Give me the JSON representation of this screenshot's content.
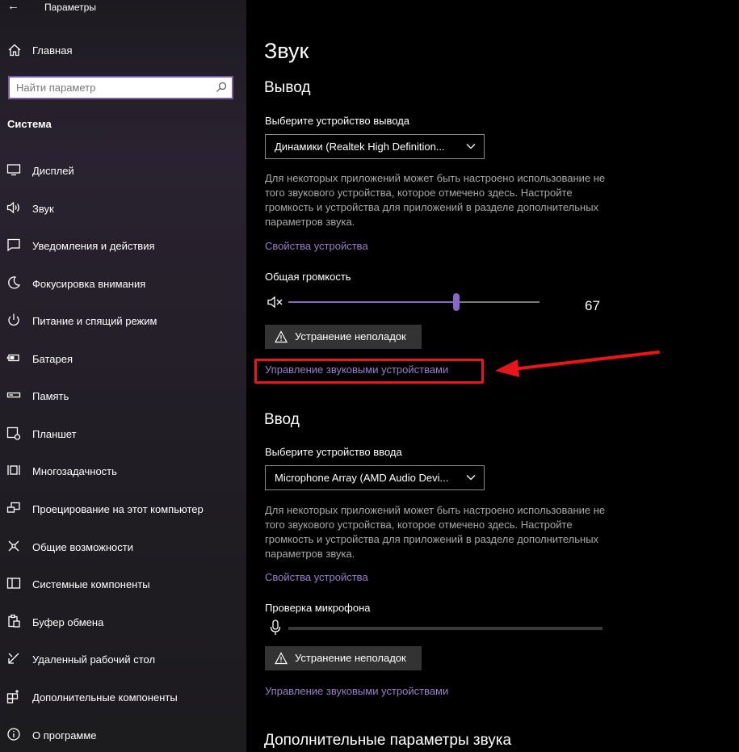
{
  "window": {
    "title": "Параметры"
  },
  "sidebar": {
    "home_label": "Главная",
    "search_placeholder": "Найти параметр",
    "section_title": "Система",
    "items": [
      {
        "label": "Дисплей",
        "icon": "display-icon"
      },
      {
        "label": "Звук",
        "icon": "speaker-icon"
      },
      {
        "label": "Уведомления и действия",
        "icon": "notification-icon"
      },
      {
        "label": "Фокусировка внимания",
        "icon": "moon-icon"
      },
      {
        "label": "Питание и спящий режим",
        "icon": "power-icon"
      },
      {
        "label": "Батарея",
        "icon": "battery-icon"
      },
      {
        "label": "Память",
        "icon": "storage-icon"
      },
      {
        "label": "Планшет",
        "icon": "tablet-icon"
      },
      {
        "label": "Многозадачность",
        "icon": "multitasking-icon"
      },
      {
        "label": "Проецирование на этот компьютер",
        "icon": "projecting-icon"
      },
      {
        "label": "Общие возможности",
        "icon": "shared-experiences-icon"
      },
      {
        "label": "Системные компоненты",
        "icon": "system-components-icon"
      },
      {
        "label": "Буфер обмена",
        "icon": "clipboard-icon"
      },
      {
        "label": "Удаленный рабочий стол",
        "icon": "remote-desktop-icon"
      },
      {
        "label": "Дополнительные компоненты",
        "icon": "optional-features-icon"
      },
      {
        "label": "О программе",
        "icon": "info-icon"
      }
    ]
  },
  "main": {
    "title": "Звук",
    "output": {
      "heading": "Вывод",
      "device_label": "Выберите устройство вывода",
      "device_value": "Динамики (Realtek High Definition...",
      "note": "Для некоторых приложений может быть настроено использование не того звукового устройства, которое отмечено здесь. Настройте громкость и устройства для приложений в разделе дополнительных параметров звука.",
      "properties_link": "Свойства устройства",
      "volume_label": "Общая громкость",
      "volume_value": "67",
      "volume_fraction": 0.67,
      "troubleshoot_label": "Устранение неполадок",
      "manage_link": "Управление звуковыми устройствами"
    },
    "input": {
      "heading": "Ввод",
      "device_label": "Выберите устройство ввода",
      "device_value": "Microphone Array (AMD Audio Devi...",
      "note": "Для некоторых приложений может быть настроено использование не того звукового устройства, которое отмечено здесь. Настройте громкость и устройства для приложений в разделе дополнительных параметров звука.",
      "properties_link": "Свойства устройства",
      "mic_test_label": "Проверка микрофона",
      "mic_level_fraction": 0,
      "troubleshoot_label": "Устранение неполадок",
      "manage_link": "Управление звуковыми устройствами"
    },
    "advanced_heading": "Дополнительные параметры звука"
  },
  "colors": {
    "accent": "#8a67c6",
    "link": "#9b7fc9",
    "annotation": "#e8151b"
  }
}
